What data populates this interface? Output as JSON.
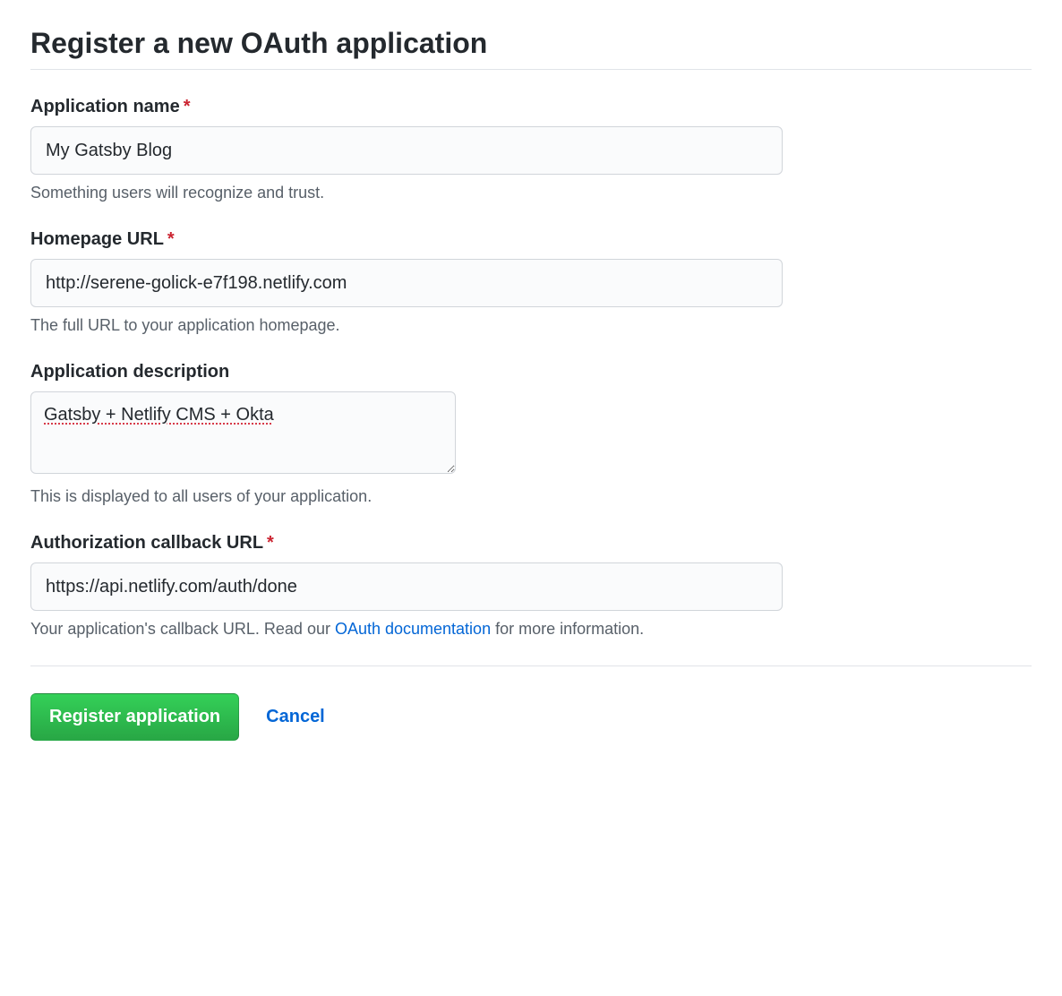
{
  "title": "Register a new OAuth application",
  "fields": {
    "app_name": {
      "label": "Application name",
      "value": "My Gatsby Blog",
      "hint": "Something users will recognize and trust."
    },
    "homepage_url": {
      "label": "Homepage URL",
      "value": "http://serene-golick-e7f198.netlify.com",
      "hint": "The full URL to your application homepage."
    },
    "description": {
      "label": "Application description",
      "value": "Gatsby + Netlify CMS + Okta",
      "hint": "This is displayed to all users of your application."
    },
    "callback_url": {
      "label": "Authorization callback URL",
      "value": "https://api.netlify.com/auth/done",
      "hint_before": "Your application's callback URL. Read our ",
      "hint_link": "OAuth documentation",
      "hint_after": " for more information."
    }
  },
  "actions": {
    "submit": "Register application",
    "cancel": "Cancel"
  },
  "asterisk": "*"
}
